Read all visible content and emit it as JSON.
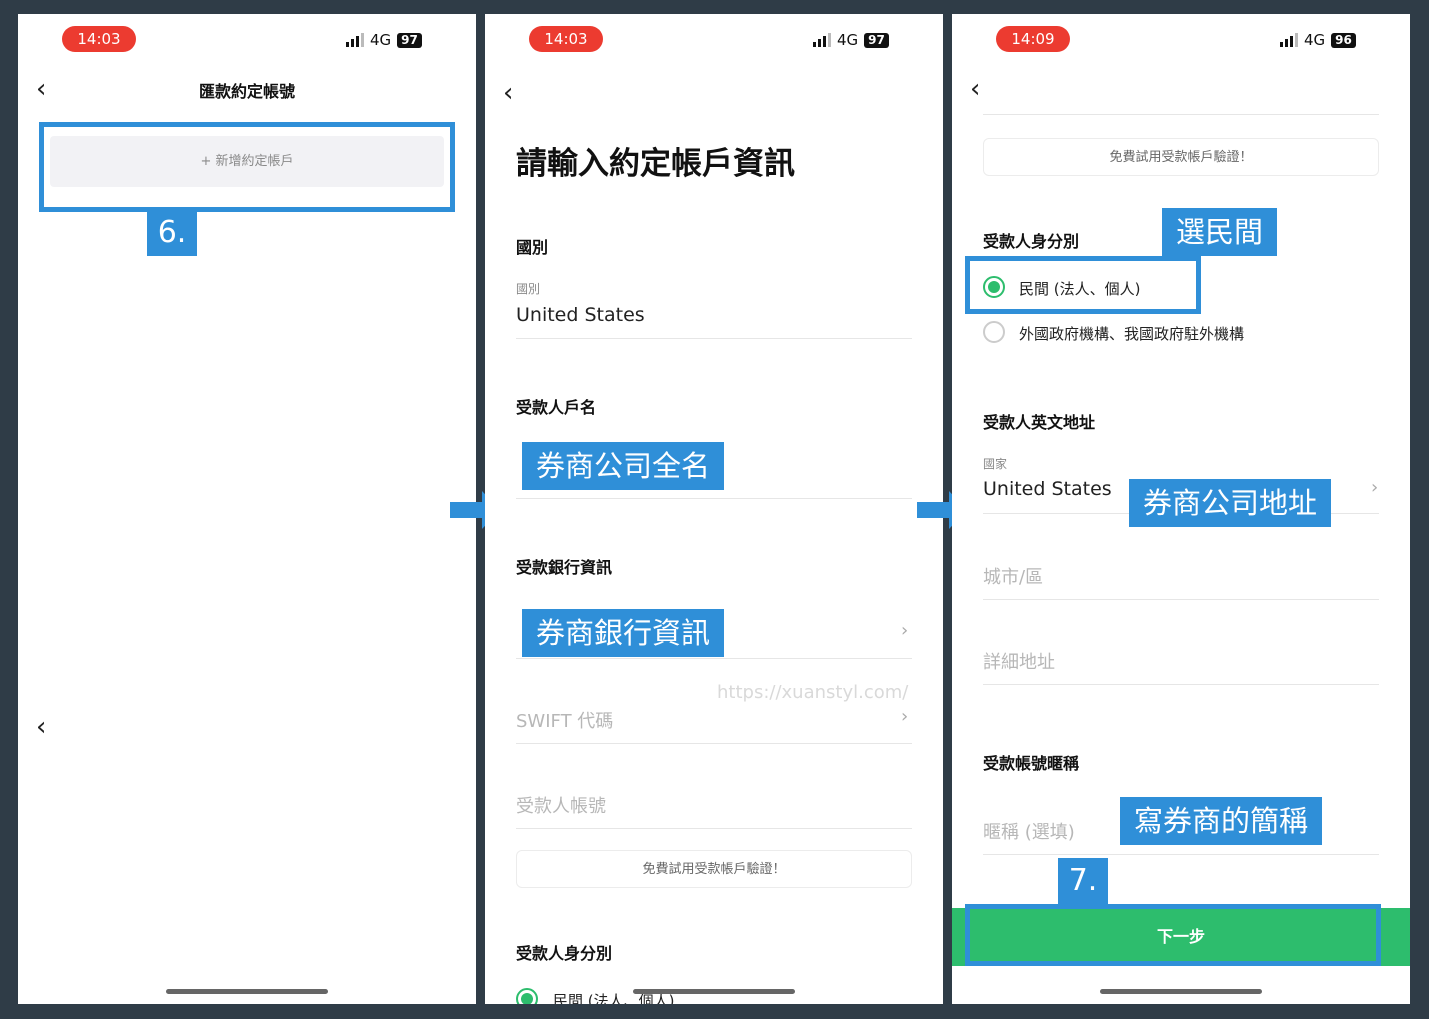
{
  "screen1": {
    "time": "14:03",
    "network": "4G",
    "battery": "97",
    "title": "匯款約定帳號",
    "add_account_label": "+ 新增約定帳戶",
    "step_label": "6."
  },
  "screen2": {
    "time": "14:03",
    "network": "4G",
    "battery": "97",
    "heading": "請輸入約定帳戶資訊",
    "country_section": "國別",
    "country_small_label": "國別",
    "country_value": "United States",
    "payee_name_section": "受款人戶名",
    "payee_name_callout": "券商公司全名",
    "bank_section": "受款銀行資訊",
    "bank_callout": "券商銀行資訊",
    "watermark": "https://xuanstyl.com/",
    "swift_placeholder": "SWIFT 代碼",
    "account_placeholder": "受款人帳號",
    "verify_text": "免費試用受款帳戶驗證！",
    "identity_section": "受款人身分別",
    "radio_private_partial": "民間 (法人、個人)"
  },
  "screen3": {
    "time": "14:09",
    "network": "4G",
    "battery": "96",
    "verify_text": "免費試用受款帳戶驗證！",
    "identity_section": "受款人身分別",
    "identity_callout": "選民間",
    "radio_private": "民間 (法人、個人)",
    "radio_foreign": "外國政府機構、我國政府駐外機構",
    "address_section": "受款人英文地址",
    "country_small_label": "國家",
    "country_value": "United States",
    "address_callout": "券商公司地址",
    "city_placeholder": "城市/區",
    "detail_placeholder": "詳細地址",
    "nickname_section": "受款帳號暱稱",
    "nickname_placeholder": "暱稱 (選填)",
    "nickname_callout": "寫券商的簡稱",
    "step_label": "7.",
    "next_button": "下一步"
  },
  "colors": {
    "background": "#2f3c47",
    "callout_blue": "#2f8fd8",
    "time_pill_red": "#ec3b30",
    "primary_green": "#2dbd6d"
  },
  "icons": [
    "back-chevron-icon",
    "signal-icon",
    "battery-icon",
    "forward-chevron-icon",
    "next-arrow-icon",
    "radio-selected-icon",
    "radio-unselected-icon"
  ]
}
